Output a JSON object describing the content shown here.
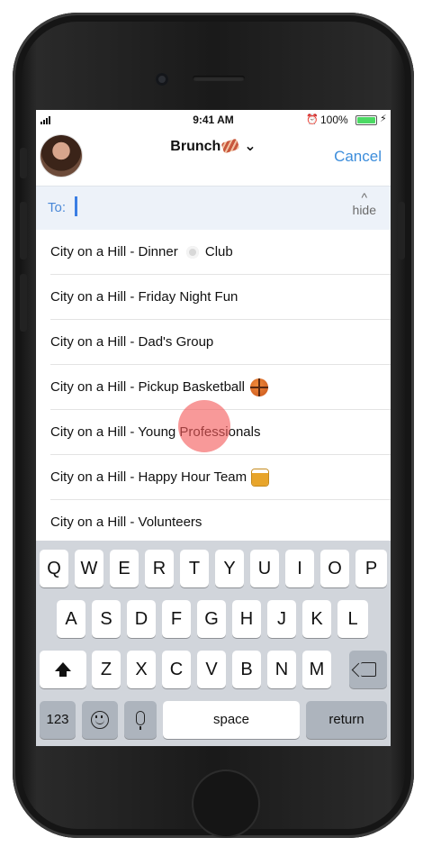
{
  "status_bar": {
    "time": "9:41 AM",
    "battery": "100%"
  },
  "header": {
    "title": "Brunch",
    "cancel_label": "Cancel"
  },
  "recipient_bar": {
    "to_label": "To:",
    "hide_label": "hide"
  },
  "groups": [
    {
      "name": "City on a Hill - Dinner",
      "suffix": "Club",
      "icon": "plate-icon"
    },
    {
      "name": "City on a Hill - Friday Night Fun",
      "suffix": "",
      "icon": ""
    },
    {
      "name": "City on a Hill - Dad's Group",
      "suffix": "",
      "icon": ""
    },
    {
      "name": "City on a Hill - Pickup Basketball",
      "suffix": "",
      "icon": "basketball-icon"
    },
    {
      "name": "City on a Hill - Young Professionals",
      "suffix": "",
      "icon": ""
    },
    {
      "name": "City on a Hill - Happy Hour Team",
      "suffix": "",
      "icon": "beer-icon"
    },
    {
      "name": "City on a Hill - Volunteers",
      "suffix": "",
      "icon": ""
    }
  ],
  "keyboard": {
    "row1": [
      "Q",
      "W",
      "E",
      "R",
      "T",
      "Y",
      "U",
      "I",
      "O",
      "P"
    ],
    "row2": [
      "A",
      "S",
      "D",
      "F",
      "G",
      "H",
      "J",
      "K",
      "L"
    ],
    "row3": [
      "Z",
      "X",
      "C",
      "V",
      "B",
      "N",
      "M"
    ],
    "numbers_label": "123",
    "space_label": "space",
    "return_label": "return"
  },
  "colors": {
    "accent": "#3c8ddb",
    "to_bar_bg": "#edf2f9",
    "touch": "#f45a5a",
    "keyboard_bg": "#d1d5db"
  }
}
